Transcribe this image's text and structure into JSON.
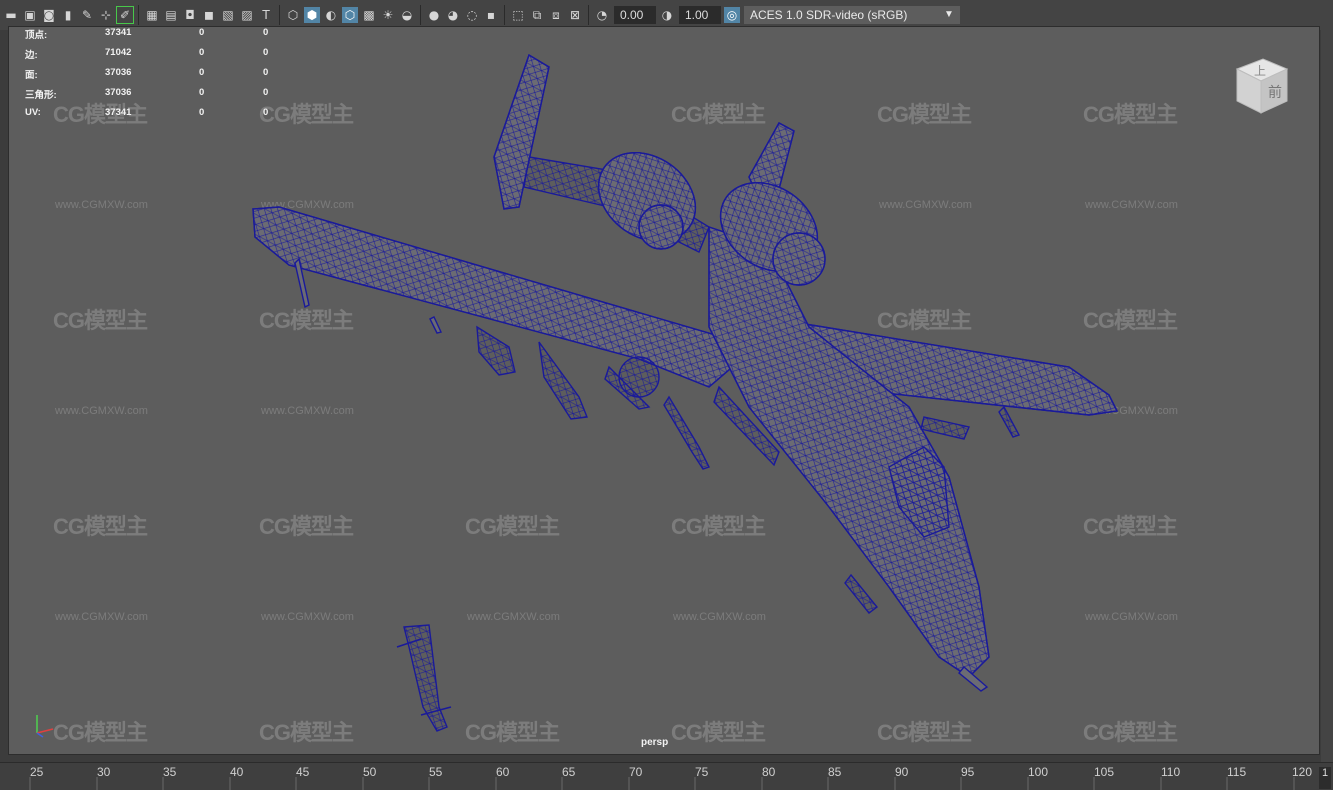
{
  "toolbar": {
    "exposure_value": "0.00",
    "gamma_value": "1.00",
    "color_space": "ACES 1.0 SDR-video (sRGB)"
  },
  "hud": {
    "rows": [
      {
        "label": "顶点:",
        "v1": "37341",
        "v2": "0",
        "v3": "0"
      },
      {
        "label": "边:",
        "v1": "71042",
        "v2": "0",
        "v3": "0"
      },
      {
        "label": "面:",
        "v1": "37036",
        "v2": "0",
        "v3": "0"
      },
      {
        "label": "三角形:",
        "v1": "37036",
        "v2": "0",
        "v3": "0"
      },
      {
        "label": "UV:",
        "v1": "37341",
        "v2": "0",
        "v3": "0"
      }
    ]
  },
  "viewcube": {
    "top": "上",
    "front": "前"
  },
  "camera_label": "persp",
  "watermark": {
    "logo": "CG模型主",
    "url": "www.CGMXW.com"
  },
  "timeline": {
    "ticks": [
      "25",
      "30",
      "35",
      "40",
      "45",
      "50",
      "55",
      "60",
      "65",
      "70",
      "75",
      "80",
      "85",
      "90",
      "95",
      "100",
      "105",
      "110",
      "115",
      "120"
    ],
    "current_frame": "1"
  },
  "colors": {
    "wireframe": "#1a1a9a",
    "viewport_bg": "#5d5d5d"
  }
}
